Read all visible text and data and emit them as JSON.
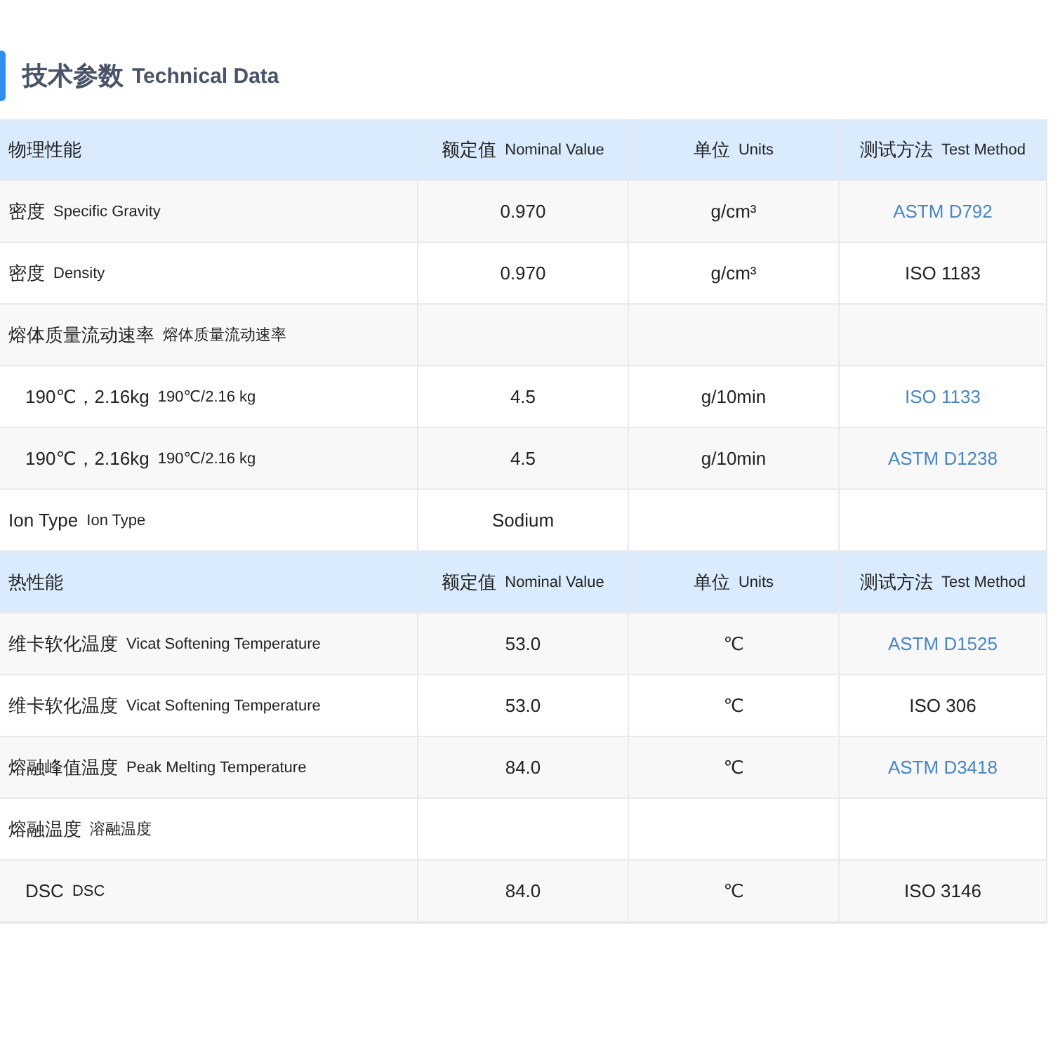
{
  "title": {
    "cn": "技术参数",
    "en": "Technical Data"
  },
  "sections": [
    {
      "header": {
        "name": "物理性能",
        "columns": [
          {
            "cn": "额定值",
            "en": "Nominal Value"
          },
          {
            "cn": "单位",
            "en": "Units"
          },
          {
            "cn": "测试方法",
            "en": "Test Method"
          }
        ]
      },
      "rows": [
        {
          "cn": "密度",
          "en": "Specific Gravity",
          "value": "0.970",
          "unit": "g/cm³",
          "method": "ASTM D792",
          "link": true
        },
        {
          "cn": "密度",
          "en": "Density",
          "value": "0.970",
          "unit": "g/cm³",
          "method": "ISO 1183",
          "link": false
        },
        {
          "cn": "熔体质量流动速率",
          "en": "熔体质量流动速率",
          "children": [
            {
              "cn": "190℃，2.16kg",
              "en": "190℃/2.16 kg",
              "value": "4.5",
              "unit": "g/10min",
              "method": "ISO 1133",
              "link": true
            },
            {
              "cn": "190℃，2.16kg",
              "en": "190℃/2.16 kg",
              "value": "4.5",
              "unit": "g/10min",
              "method": "ASTM D1238",
              "link": true
            }
          ]
        },
        {
          "cn": "Ion Type",
          "en": "Ion Type",
          "value": "Sodium"
        }
      ]
    },
    {
      "header": {
        "name": "热性能",
        "columns": [
          {
            "cn": "额定值",
            "en": "Nominal Value"
          },
          {
            "cn": "单位",
            "en": "Units"
          },
          {
            "cn": "测试方法",
            "en": "Test Method"
          }
        ]
      },
      "rows": [
        {
          "cn": "维卡软化温度",
          "en": "Vicat Softening Temperature",
          "value": "53.0",
          "unit": "℃",
          "method": "ASTM D1525",
          "link": true
        },
        {
          "cn": "维卡软化温度",
          "en": "Vicat Softening Temperature",
          "value": "53.0",
          "unit": "℃",
          "method": "ISO 306",
          "link": false
        },
        {
          "cn": "熔融峰值温度",
          "en": "Peak Melting Temperature",
          "value": "84.0",
          "unit": "℃",
          "method": "ASTM D3418",
          "link": true
        },
        {
          "cn": "熔融温度",
          "en": "溶融温度",
          "children": [
            {
              "cn": "DSC",
              "en": "DSC",
              "value": "84.0",
              "unit": "℃",
              "method": "ISO 3146",
              "link": false
            }
          ]
        }
      ]
    }
  ]
}
